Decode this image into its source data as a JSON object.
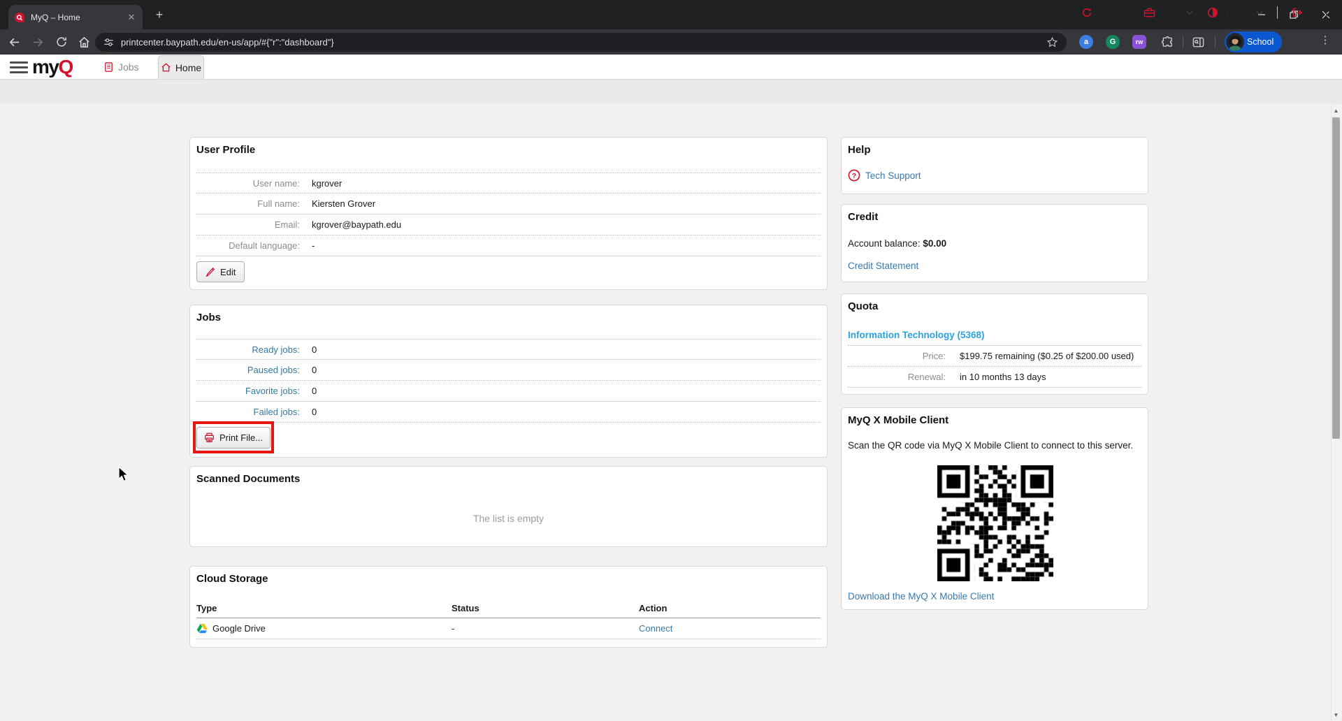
{
  "browser": {
    "tab_title": "MyQ – Home",
    "url": "printcenter.baypath.edu/en-us/app/#{\"r\":\"dashboard\"}",
    "profile_label": "School",
    "extensions": {
      "reader_letter": "a",
      "grammarly_letter": "G",
      "readwrite_letter": "rw"
    }
  },
  "app_header": {
    "logo_my": "my",
    "logo_q": "Q",
    "nav_jobs": "Jobs",
    "nav_home": "Home"
  },
  "action_bar": {
    "refresh": "Refresh",
    "tools": "Tools",
    "theme": "Theme",
    "logout": "Log out"
  },
  "user_profile": {
    "title": "User Profile",
    "rows": [
      {
        "label": "User name:",
        "value": "kgrover"
      },
      {
        "label": "Full name:",
        "value": "Kiersten Grover"
      },
      {
        "label": "Email:",
        "value": "kgrover@baypath.edu"
      },
      {
        "label": "Default language:",
        "value": "-"
      }
    ],
    "edit_button": "Edit"
  },
  "jobs": {
    "title": "Jobs",
    "rows": [
      {
        "label": "Ready jobs:",
        "value": "0"
      },
      {
        "label": "Paused jobs:",
        "value": "0"
      },
      {
        "label": "Favorite jobs:",
        "value": "0"
      },
      {
        "label": "Failed jobs:",
        "value": "0"
      }
    ],
    "print_file_button": "Print File..."
  },
  "scanned_documents": {
    "title": "Scanned Documents",
    "empty_text": "The list is empty"
  },
  "cloud_storage": {
    "title": "Cloud Storage",
    "columns": {
      "type": "Type",
      "status": "Status",
      "action": "Action"
    },
    "rows": [
      {
        "type": "Google Drive",
        "status": "-",
        "action": "Connect"
      }
    ]
  },
  "help": {
    "title": "Help",
    "tech_support_link": "Tech Support"
  },
  "credit": {
    "title": "Credit",
    "balance_label": "Account balance:",
    "balance_value": "$0.00",
    "statement_link": "Credit Statement"
  },
  "quota": {
    "title": "Quota",
    "group_link": "Information Technology (5368)",
    "rows": [
      {
        "label": "Price:",
        "value": "$199.75 remaining ($0.25 of $200.00 used)"
      },
      {
        "label": "Renewal:",
        "value": "in 10 months 13 days"
      }
    ]
  },
  "mobile_client": {
    "title": "MyQ X Mobile Client",
    "description": "Scan the QR code via MyQ X Mobile Client to connect to this server.",
    "download_link": "Download the MyQ X Mobile Client"
  },
  "colors": {
    "brand_red": "#d5112c",
    "link_blue": "#3878ab",
    "jobs_link_blue": "#34799d",
    "quota_group_link": "#2ba3dc",
    "annotation_red": "#e9150d",
    "profile_chip_blue": "#0b57d0"
  }
}
